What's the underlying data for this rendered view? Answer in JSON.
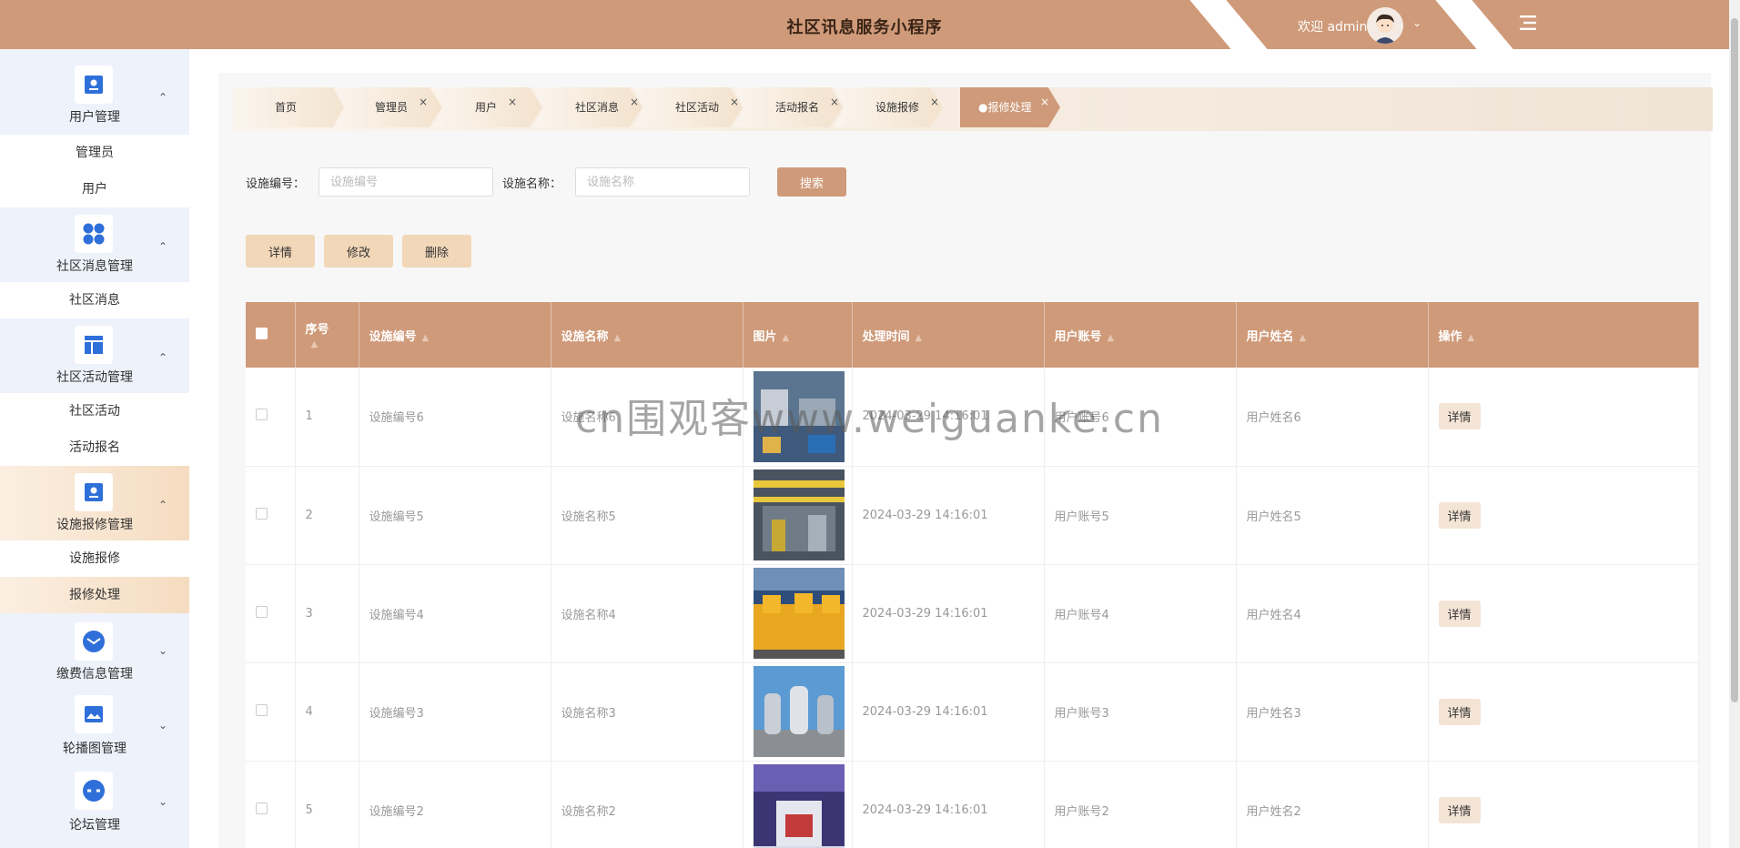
{
  "header": {
    "title": "社区讯息服务小程序",
    "welcome": "欢迎 admin",
    "colors": {
      "primary": "#cf9a79",
      "accent_light": "#f2d7b8"
    }
  },
  "sidebar": {
    "groups": [
      {
        "label": "用户管理",
        "icon": "user-card-icon",
        "expanded": true,
        "items": [
          "管理员",
          "用户"
        ]
      },
      {
        "label": "社区消息管理",
        "icon": "grid-circles-icon",
        "expanded": true,
        "items": [
          "社区消息"
        ]
      },
      {
        "label": "社区活动管理",
        "icon": "layout-icon",
        "expanded": true,
        "items": [
          "社区活动",
          "活动报名"
        ]
      },
      {
        "label": "设施报修管理",
        "icon": "user-card-icon",
        "expanded": true,
        "items": [
          "设施报修",
          "报修处理"
        ]
      },
      {
        "label": "缴费信息管理",
        "icon": "mail-icon",
        "expanded": false
      },
      {
        "label": "轮播图管理",
        "icon": "image-icon",
        "expanded": false
      },
      {
        "label": "论坛管理",
        "icon": "forum-icon",
        "expanded": false
      }
    ],
    "active_item": "报修处理"
  },
  "tabs": [
    {
      "label": "首页"
    },
    {
      "label": "管理员"
    },
    {
      "label": "用户"
    },
    {
      "label": "社区消息"
    },
    {
      "label": "社区活动"
    },
    {
      "label": "活动报名"
    },
    {
      "label": "设施报修"
    },
    {
      "label": "●报修处理",
      "active": true
    }
  ],
  "search": {
    "field1_label": "设施编号：",
    "field1_placeholder": "设施编号",
    "field2_label": "设施名称：",
    "field2_placeholder": "设施名称",
    "button": "搜索"
  },
  "actions": {
    "detail": "详情",
    "edit": "修改",
    "delete": "删除"
  },
  "table": {
    "columns": [
      "序号",
      "设施编号",
      "设施名称",
      "图片",
      "处理时间",
      "用户账号",
      "用户姓名",
      "操作"
    ],
    "rows": [
      {
        "index": "1",
        "code": "设施编号6",
        "name": "设施名称6",
        "time": "2024-03-29 14:16:01",
        "account": "用户账号6",
        "uname": "用户姓名6",
        "op": "详情",
        "image": "industrial-workshop"
      },
      {
        "index": "2",
        "code": "设施编号5",
        "name": "设施名称5",
        "time": "2024-03-29 14:16:01",
        "account": "用户账号5",
        "uname": "用户姓名5",
        "op": "详情",
        "image": "factory-crane-hall"
      },
      {
        "index": "3",
        "code": "设施编号4",
        "name": "设施名称4",
        "time": "2024-03-29 14:16:01",
        "account": "用户账号4",
        "uname": "用户姓名4",
        "op": "详情",
        "image": "yellow-machines-row"
      },
      {
        "index": "4",
        "code": "设施编号3",
        "name": "设施名称3",
        "time": "2024-03-29 14:16:01",
        "account": "用户账号3",
        "uname": "用户姓名3",
        "op": "详情",
        "image": "steel-tanks"
      },
      {
        "index": "5",
        "code": "设施编号2",
        "name": "设施名称2",
        "time": "2024-03-29 14:16:01",
        "account": "用户账号2",
        "uname": "用户姓名2",
        "op": "详情",
        "image": "exhibition-machine"
      }
    ]
  },
  "watermark": "cn围观客www.weiguanke.cn"
}
